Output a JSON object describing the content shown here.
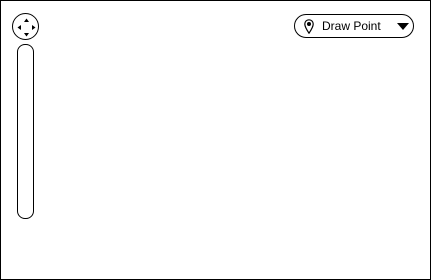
{
  "map": {
    "pan_control": {
      "icon": "pan-arrows-icon",
      "directions": [
        "up",
        "down",
        "left",
        "right"
      ]
    },
    "zoom_slider": {
      "icon": "zoom-slider"
    },
    "mode_select": {
      "icon": "map-pin-icon",
      "selected_label": "Draw Point",
      "dropdown_icon": "caret-down-icon"
    }
  }
}
